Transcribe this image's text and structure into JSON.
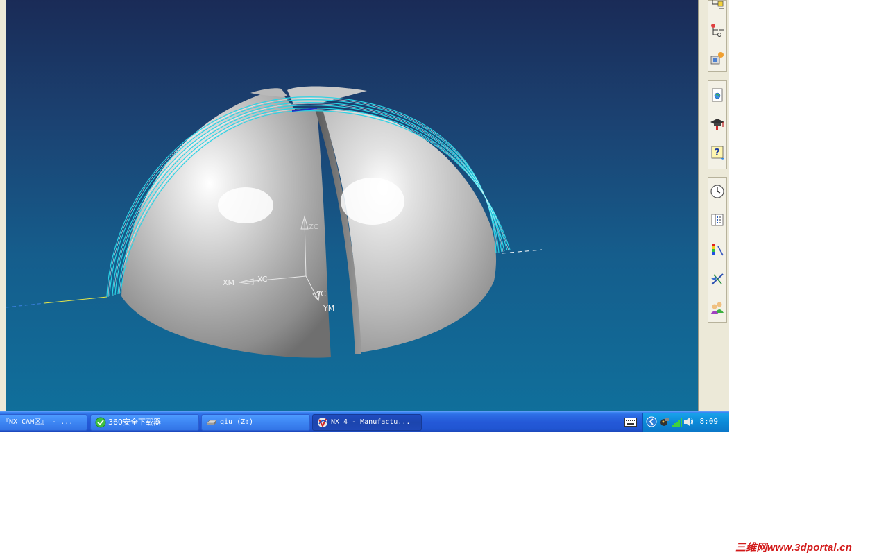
{
  "viewport": {
    "axis_labels": {
      "xm": "XM",
      "xc": "XC",
      "yc": "YC",
      "ym": "YM",
      "zc": "ZC"
    }
  },
  "right_toolbar": {
    "buttons": [
      {
        "icon": "assembly-navigator-icon"
      },
      {
        "icon": "part-navigator-icon"
      },
      {
        "icon": "reuse-library-icon"
      },
      {
        "icon": "web-browser-icon"
      },
      {
        "icon": "training-icon"
      },
      {
        "icon": "help-icon"
      },
      {
        "icon": "history-icon"
      },
      {
        "icon": "system-materials-icon"
      },
      {
        "icon": "visualization-icon"
      },
      {
        "icon": "process-studio-icon"
      },
      {
        "icon": "roles-icon"
      }
    ]
  },
  "taskbar": {
    "tasks": [
      {
        "label": "『NX CAM区』 - ...",
        "icon": "browser-icon"
      },
      {
        "label": "360安全下载器",
        "icon": "360-icon"
      },
      {
        "label": "qiu (Z:)",
        "icon": "drive-icon"
      },
      {
        "label": "NX 4 - Manufactu...",
        "icon": "nx-icon",
        "active": true
      }
    ],
    "clock": "8:09"
  },
  "watermark": "三维网www.3dportal.cn",
  "colors": {
    "viewport_top": "#1a2b57",
    "viewport_bottom": "#106f9b",
    "toolpath": "#2ad4e6",
    "taskbar": "#2459d8",
    "watermark": "#d21a1a"
  }
}
